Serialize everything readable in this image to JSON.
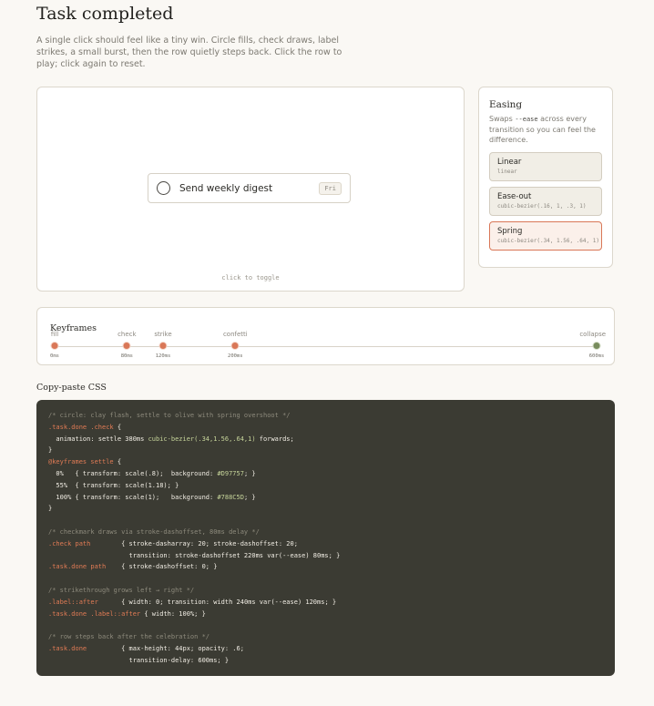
{
  "page": {
    "title": "Task completed",
    "intro": "A single click should feel like a tiny win. Circle fills, check draws, label strikes, a small burst, then the row quietly steps back. Click the row to play; click again to reset."
  },
  "stage": {
    "task_label": "Send weekly digest",
    "task_badge": "Fri",
    "hint": "click to toggle"
  },
  "easing": {
    "title": "Easing",
    "desc_before": "Swaps ",
    "desc_code": "--ease",
    "desc_after": " across every transition so you can feel the difference.",
    "selected": "Spring",
    "options": [
      {
        "name": "Linear",
        "code": "linear"
      },
      {
        "name": "Ease-out",
        "code": "cubic-bezier(.16, 1, .3, 1)"
      },
      {
        "name": "Spring",
        "code": "cubic-bezier(.34, 1.56, .64, 1)"
      }
    ]
  },
  "keyframes": {
    "title": "Keyframes",
    "timeline_end_ms": 600,
    "marks": [
      {
        "label": "fill",
        "time": "0ms",
        "ms": 0,
        "color": "clay"
      },
      {
        "label": "check",
        "time": "80ms",
        "ms": 80,
        "color": "clay"
      },
      {
        "label": "strike",
        "time": "120ms",
        "ms": 120,
        "color": "clay"
      },
      {
        "label": "confetti",
        "time": "200ms",
        "ms": 200,
        "color": "clay"
      },
      {
        "label": "collapse",
        "time": "600ms",
        "ms": 600,
        "color": "olive"
      }
    ]
  },
  "css_section": {
    "title": "Copy-paste CSS",
    "lines": [
      [
        [
          "com",
          "/* circle: clay flash, settle to olive with spring overshoot */"
        ]
      ],
      [
        [
          "sel",
          ".task.done .check"
        ],
        [
          "txt",
          " {"
        ]
      ],
      [
        [
          "txt",
          "  animation: settle 380ms "
        ],
        [
          "fn",
          "cubic-bezier(.34,1.56,.64,1)"
        ],
        [
          "txt",
          " forwards;"
        ]
      ],
      [
        [
          "txt",
          "}"
        ]
      ],
      [
        [
          "sel",
          "@keyframes settle"
        ],
        [
          "txt",
          " {"
        ]
      ],
      [
        [
          "txt",
          "  0%   { transform: scale(.8);  background: "
        ],
        [
          "fn",
          "#D97757"
        ],
        [
          "txt",
          "; }"
        ]
      ],
      [
        [
          "txt",
          "  55%  { transform: scale(1.18); }"
        ]
      ],
      [
        [
          "txt",
          "  100% { transform: scale(1);   background: "
        ],
        [
          "fn",
          "#788C5D"
        ],
        [
          "txt",
          "; }"
        ]
      ],
      [
        [
          "txt",
          "}"
        ]
      ],
      [],
      [
        [
          "com",
          "/* checkmark draws via stroke-dashoffset, 80ms delay */"
        ]
      ],
      [
        [
          "sel",
          ".check path"
        ],
        [
          "txt",
          "        { stroke-dasharray: 20; stroke-dashoffset: 20;"
        ]
      ],
      [
        [
          "txt",
          "                     transition: stroke-dashoffset 220ms var(--ease) 80ms; }"
        ]
      ],
      [
        [
          "sel",
          ".task.done path"
        ],
        [
          "txt",
          "    { stroke-dashoffset: 0; }"
        ]
      ],
      [],
      [
        [
          "com",
          "/* strikethrough grows left → right */"
        ]
      ],
      [
        [
          "sel",
          ".label::after"
        ],
        [
          "txt",
          "      { width: 0; transition: width 240ms var(--ease) 120ms; }"
        ]
      ],
      [
        [
          "sel",
          ".task.done .label::after"
        ],
        [
          "txt",
          " { width: 100%; }"
        ]
      ],
      [],
      [
        [
          "com",
          "/* row steps back after the celebration */"
        ]
      ],
      [
        [
          "sel",
          ".task.done"
        ],
        [
          "txt",
          "         { max-height: 44px; opacity: .6;"
        ]
      ],
      [
        [
          "txt",
          "                     transition-delay: 600ms; }"
        ]
      ]
    ]
  }
}
